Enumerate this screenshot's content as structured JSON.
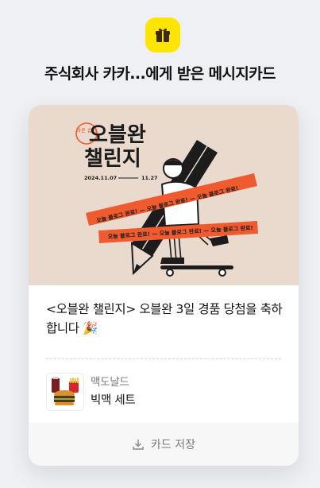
{
  "header": {
    "app_icon": "gift-box-icon",
    "title": "주식회사 카카...에게 받은 메시지카드"
  },
  "card": {
    "banner": {
      "badge": "바른 습관",
      "title_line1": "오블완",
      "title_line2": "챌린지",
      "date_start": "2024.11.07",
      "date_end": "11.27",
      "ribbon_text": "오늘 블로그 완료! — 오늘 블로그 완료! — 오늘 블로그 완료!"
    },
    "message": "<오블완 챌린지> 오블완 3일 경품 당첨을 축하합니다 🎉",
    "product": {
      "brand": "맥도날드",
      "name": "빅맥 세트",
      "thumb_icon": "bigmac-set-image"
    },
    "save_button": {
      "label": "카드 저장",
      "icon": "download-icon"
    }
  },
  "colors": {
    "accent_yellow": "#fee500",
    "banner_bg": "#ead9cd",
    "ribbon_orange": "#ef5a2f"
  }
}
